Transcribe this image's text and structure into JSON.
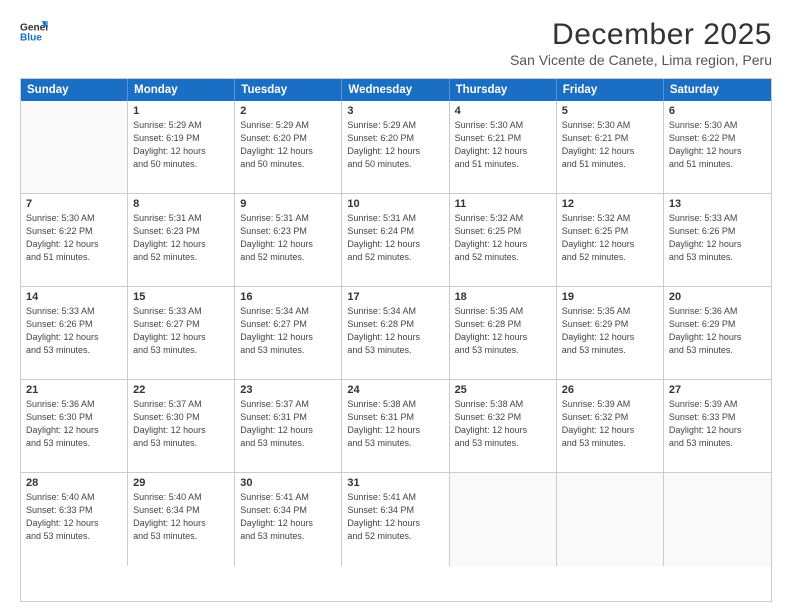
{
  "logo": {
    "line1": "General",
    "line2": "Blue"
  },
  "title": "December 2025",
  "subtitle": "San Vicente de Canete, Lima region, Peru",
  "header_days": [
    "Sunday",
    "Monday",
    "Tuesday",
    "Wednesday",
    "Thursday",
    "Friday",
    "Saturday"
  ],
  "weeks": [
    [
      {
        "day": "",
        "info": ""
      },
      {
        "day": "1",
        "info": "Sunrise: 5:29 AM\nSunset: 6:19 PM\nDaylight: 12 hours\nand 50 minutes."
      },
      {
        "day": "2",
        "info": "Sunrise: 5:29 AM\nSunset: 6:20 PM\nDaylight: 12 hours\nand 50 minutes."
      },
      {
        "day": "3",
        "info": "Sunrise: 5:29 AM\nSunset: 6:20 PM\nDaylight: 12 hours\nand 50 minutes."
      },
      {
        "day": "4",
        "info": "Sunrise: 5:30 AM\nSunset: 6:21 PM\nDaylight: 12 hours\nand 51 minutes."
      },
      {
        "day": "5",
        "info": "Sunrise: 5:30 AM\nSunset: 6:21 PM\nDaylight: 12 hours\nand 51 minutes."
      },
      {
        "day": "6",
        "info": "Sunrise: 5:30 AM\nSunset: 6:22 PM\nDaylight: 12 hours\nand 51 minutes."
      }
    ],
    [
      {
        "day": "7",
        "info": "Sunrise: 5:30 AM\nSunset: 6:22 PM\nDaylight: 12 hours\nand 51 minutes."
      },
      {
        "day": "8",
        "info": "Sunrise: 5:31 AM\nSunset: 6:23 PM\nDaylight: 12 hours\nand 52 minutes."
      },
      {
        "day": "9",
        "info": "Sunrise: 5:31 AM\nSunset: 6:23 PM\nDaylight: 12 hours\nand 52 minutes."
      },
      {
        "day": "10",
        "info": "Sunrise: 5:31 AM\nSunset: 6:24 PM\nDaylight: 12 hours\nand 52 minutes."
      },
      {
        "day": "11",
        "info": "Sunrise: 5:32 AM\nSunset: 6:25 PM\nDaylight: 12 hours\nand 52 minutes."
      },
      {
        "day": "12",
        "info": "Sunrise: 5:32 AM\nSunset: 6:25 PM\nDaylight: 12 hours\nand 52 minutes."
      },
      {
        "day": "13",
        "info": "Sunrise: 5:33 AM\nSunset: 6:26 PM\nDaylight: 12 hours\nand 53 minutes."
      }
    ],
    [
      {
        "day": "14",
        "info": "Sunrise: 5:33 AM\nSunset: 6:26 PM\nDaylight: 12 hours\nand 53 minutes."
      },
      {
        "day": "15",
        "info": "Sunrise: 5:33 AM\nSunset: 6:27 PM\nDaylight: 12 hours\nand 53 minutes."
      },
      {
        "day": "16",
        "info": "Sunrise: 5:34 AM\nSunset: 6:27 PM\nDaylight: 12 hours\nand 53 minutes."
      },
      {
        "day": "17",
        "info": "Sunrise: 5:34 AM\nSunset: 6:28 PM\nDaylight: 12 hours\nand 53 minutes."
      },
      {
        "day": "18",
        "info": "Sunrise: 5:35 AM\nSunset: 6:28 PM\nDaylight: 12 hours\nand 53 minutes."
      },
      {
        "day": "19",
        "info": "Sunrise: 5:35 AM\nSunset: 6:29 PM\nDaylight: 12 hours\nand 53 minutes."
      },
      {
        "day": "20",
        "info": "Sunrise: 5:36 AM\nSunset: 6:29 PM\nDaylight: 12 hours\nand 53 minutes."
      }
    ],
    [
      {
        "day": "21",
        "info": "Sunrise: 5:36 AM\nSunset: 6:30 PM\nDaylight: 12 hours\nand 53 minutes."
      },
      {
        "day": "22",
        "info": "Sunrise: 5:37 AM\nSunset: 6:30 PM\nDaylight: 12 hours\nand 53 minutes."
      },
      {
        "day": "23",
        "info": "Sunrise: 5:37 AM\nSunset: 6:31 PM\nDaylight: 12 hours\nand 53 minutes."
      },
      {
        "day": "24",
        "info": "Sunrise: 5:38 AM\nSunset: 6:31 PM\nDaylight: 12 hours\nand 53 minutes."
      },
      {
        "day": "25",
        "info": "Sunrise: 5:38 AM\nSunset: 6:32 PM\nDaylight: 12 hours\nand 53 minutes."
      },
      {
        "day": "26",
        "info": "Sunrise: 5:39 AM\nSunset: 6:32 PM\nDaylight: 12 hours\nand 53 minutes."
      },
      {
        "day": "27",
        "info": "Sunrise: 5:39 AM\nSunset: 6:33 PM\nDaylight: 12 hours\nand 53 minutes."
      }
    ],
    [
      {
        "day": "28",
        "info": "Sunrise: 5:40 AM\nSunset: 6:33 PM\nDaylight: 12 hours\nand 53 minutes."
      },
      {
        "day": "29",
        "info": "Sunrise: 5:40 AM\nSunset: 6:34 PM\nDaylight: 12 hours\nand 53 minutes."
      },
      {
        "day": "30",
        "info": "Sunrise: 5:41 AM\nSunset: 6:34 PM\nDaylight: 12 hours\nand 53 minutes."
      },
      {
        "day": "31",
        "info": "Sunrise: 5:41 AM\nSunset: 6:34 PM\nDaylight: 12 hours\nand 52 minutes."
      },
      {
        "day": "",
        "info": ""
      },
      {
        "day": "",
        "info": ""
      },
      {
        "day": "",
        "info": ""
      }
    ]
  ]
}
